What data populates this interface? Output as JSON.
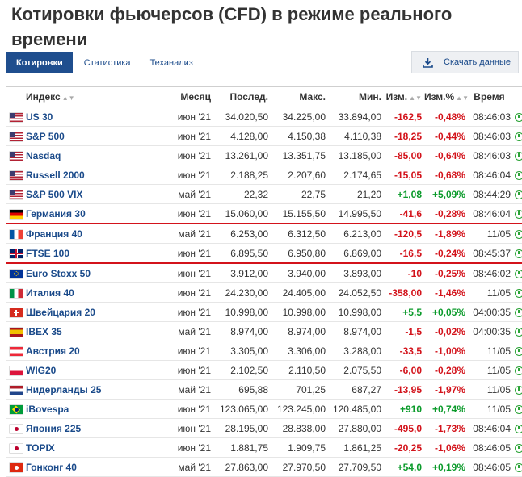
{
  "page": {
    "title": "Котировки фьючерсов (CFD) в режиме реального времени"
  },
  "tabs": [
    {
      "label": "Котировки",
      "active": true
    },
    {
      "label": "Статистика",
      "active": false
    },
    {
      "label": "Теханализ",
      "active": false
    }
  ],
  "download": {
    "label": "Скачать данные",
    "icon": "download-icon"
  },
  "table": {
    "headers": {
      "index": "Индекс",
      "month": "Месяц",
      "last": "Послед.",
      "high": "Макс.",
      "low": "Мин.",
      "change": "Изм.",
      "change_pct": "Изм.%",
      "time": "Время"
    },
    "rows": [
      {
        "flag": "us",
        "name": "US 30",
        "month": "июн '21",
        "last": "34.020,50",
        "high": "34.225,00",
        "low": "33.894,00",
        "change": "-162,5",
        "change_pct": "-0,48%",
        "time": "08:46:03",
        "dir": "neg"
      },
      {
        "flag": "us",
        "name": "S&P 500",
        "month": "июн '21",
        "last": "4.128,00",
        "high": "4.150,38",
        "low": "4.110,38",
        "change": "-18,25",
        "change_pct": "-0,44%",
        "time": "08:46:03",
        "dir": "neg"
      },
      {
        "flag": "us",
        "name": "Nasdaq",
        "month": "июн '21",
        "last": "13.261,00",
        "high": "13.351,75",
        "low": "13.185,00",
        "change": "-85,00",
        "change_pct": "-0,64%",
        "time": "08:46:03",
        "dir": "neg"
      },
      {
        "flag": "us",
        "name": "Russell 2000",
        "month": "июн '21",
        "last": "2.188,25",
        "high": "2.207,60",
        "low": "2.174,65",
        "change": "-15,05",
        "change_pct": "-0,68%",
        "time": "08:46:04",
        "dir": "neg"
      },
      {
        "flag": "us",
        "name": "S&P 500 VIX",
        "month": "май '21",
        "last": "22,32",
        "high": "22,75",
        "low": "21,20",
        "change": "+1,08",
        "change_pct": "+5,09%",
        "time": "08:44:29",
        "dir": "pos"
      },
      {
        "flag": "de",
        "name": "Германия 30",
        "month": "июн '21",
        "last": "15.060,00",
        "high": "15.155,50",
        "low": "14.995,50",
        "change": "-41,6",
        "change_pct": "-0,28%",
        "time": "08:46:04",
        "dir": "neg",
        "highlight": true
      },
      {
        "flag": "fr",
        "name": "Франция 40",
        "month": "май '21",
        "last": "6.253,00",
        "high": "6.312,50",
        "low": "6.213,00",
        "change": "-120,5",
        "change_pct": "-1,89%",
        "time": "11/05",
        "dir": "neg"
      },
      {
        "flag": "gb",
        "name": "FTSE 100",
        "month": "июн '21",
        "last": "6.895,50",
        "high": "6.950,80",
        "low": "6.869,00",
        "change": "-16,5",
        "change_pct": "-0,24%",
        "time": "08:45:37",
        "dir": "neg",
        "highlight": true
      },
      {
        "flag": "eu",
        "name": "Euro Stoxx 50",
        "month": "июн '21",
        "last": "3.912,00",
        "high": "3.940,00",
        "low": "3.893,00",
        "change": "-10",
        "change_pct": "-0,25%",
        "time": "08:46:02",
        "dir": "neg"
      },
      {
        "flag": "it",
        "name": "Италия 40",
        "month": "июн '21",
        "last": "24.230,00",
        "high": "24.405,00",
        "low": "24.052,50",
        "change": "-358,00",
        "change_pct": "-1,46%",
        "time": "11/05",
        "dir": "neg"
      },
      {
        "flag": "ch",
        "name": "Швейцария 20",
        "month": "июн '21",
        "last": "10.998,00",
        "high": "10.998,00",
        "low": "10.998,00",
        "change": "+5,5",
        "change_pct": "+0,05%",
        "time": "04:00:35",
        "dir": "pos"
      },
      {
        "flag": "es",
        "name": "IBEX 35",
        "month": "май '21",
        "last": "8.974,00",
        "high": "8.974,00",
        "low": "8.974,00",
        "change": "-1,5",
        "change_pct": "-0,02%",
        "time": "04:00:35",
        "dir": "neg"
      },
      {
        "flag": "at",
        "name": "Австрия 20",
        "month": "июн '21",
        "last": "3.305,00",
        "high": "3.306,00",
        "low": "3.288,00",
        "change": "-33,5",
        "change_pct": "-1,00%",
        "time": "11/05",
        "dir": "neg"
      },
      {
        "flag": "pl",
        "name": "WIG20",
        "month": "июн '21",
        "last": "2.102,50",
        "high": "2.110,50",
        "low": "2.075,50",
        "change": "-6,00",
        "change_pct": "-0,28%",
        "time": "11/05",
        "dir": "neg"
      },
      {
        "flag": "nl",
        "name": "Нидерланды 25",
        "month": "май '21",
        "last": "695,88",
        "high": "701,25",
        "low": "687,27",
        "change": "-13,95",
        "change_pct": "-1,97%",
        "time": "11/05",
        "dir": "neg"
      },
      {
        "flag": "br",
        "name": "iBovespa",
        "month": "июн '21",
        "last": "123.065,00",
        "high": "123.245,00",
        "low": "120.485,00",
        "change": "+910",
        "change_pct": "+0,74%",
        "time": "11/05",
        "dir": "pos"
      },
      {
        "flag": "jp",
        "name": "Япония 225",
        "month": "июн '21",
        "last": "28.195,00",
        "high": "28.838,00",
        "low": "27.880,00",
        "change": "-495,0",
        "change_pct": "-1,73%",
        "time": "08:46:04",
        "dir": "neg"
      },
      {
        "flag": "jp",
        "name": "TOPIX",
        "month": "июн '21",
        "last": "1.881,75",
        "high": "1.909,75",
        "low": "1.861,25",
        "change": "-20,25",
        "change_pct": "-1,06%",
        "time": "08:46:05",
        "dir": "neg"
      },
      {
        "flag": "hk",
        "name": "Гонконг 40",
        "month": "май '21",
        "last": "27.863,00",
        "high": "27.970,50",
        "low": "27.709,50",
        "change": "+54,0",
        "change_pct": "+0,19%",
        "time": "08:46:05",
        "dir": "pos"
      }
    ]
  },
  "colors": {
    "positive": "#0a9a2a",
    "negative": "#d3131b",
    "link": "#1a4a8a",
    "tab_active": "#1f4e8e",
    "highlight_line": "#d3131b"
  }
}
